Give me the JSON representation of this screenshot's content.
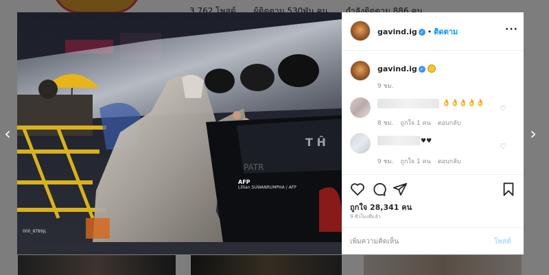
{
  "profile_bg": {
    "posts": "3,762 โพสต์",
    "followers": "ผู้ติดตาม 530พัน คน",
    "following": "กำลังติดตาม 886 คน"
  },
  "photo": {
    "credit_agency": "AFP",
    "credit_line": "Lillian SUWANRUMPHA / AFP",
    "file_code": "000_8T89JL"
  },
  "post": {
    "username": "gavind.ig",
    "follow_label": "ติดตาม",
    "caption_time": "9 ชม.",
    "comments": [
      {
        "text": "👌👌👌👌👌",
        "time": "8 ชม.",
        "likes": "ถูกใจ 1 คน",
        "reply": "ตอบกลับ"
      },
      {
        "text": "♥♥",
        "time": "9 ชม.",
        "likes": "ถูกใจ 1 คน",
        "reply": "ตอบกลับ"
      }
    ],
    "like_count": "ถูกใจ 28,341 คน",
    "posted_ago": "9 ชั่วโมงที่แล้ว",
    "comment_placeholder": "เพิ่มความคิดเห็น",
    "post_button": "โพสต์"
  },
  "icons": [
    "chevron-left-icon",
    "chevron-right-icon",
    "more-icon",
    "verified-icon",
    "heart-icon",
    "comment-icon",
    "share-icon",
    "bookmark-icon"
  ],
  "colors": {
    "link": "#0095f6",
    "verified": "#3897f0",
    "post_disabled": "#b2dffc"
  }
}
